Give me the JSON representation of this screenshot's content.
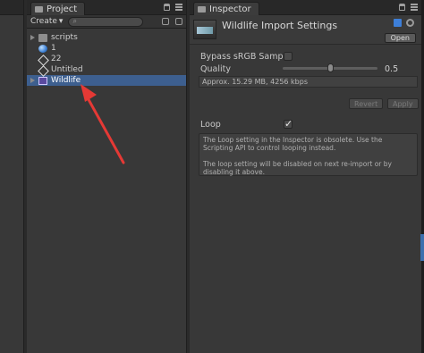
{
  "project": {
    "tab_label": "Project",
    "create_label": "Create",
    "create_arrow": "▾",
    "search_icon": "⌕",
    "items": [
      {
        "label": "scripts",
        "icon": "folder-icon",
        "expandable": true,
        "selected": false
      },
      {
        "label": "1",
        "icon": "sphere-icon",
        "expandable": false,
        "selected": false
      },
      {
        "label": "22",
        "icon": "unity-scene-icon",
        "expandable": false,
        "selected": false
      },
      {
        "label": "Untitled",
        "icon": "unity-scene-icon",
        "expandable": false,
        "selected": false
      },
      {
        "label": "Wildlife",
        "icon": "video-clip-icon",
        "expandable": true,
        "selected": true
      }
    ]
  },
  "inspector": {
    "tab_label": "Inspector",
    "title": "Wildlife Import Settings",
    "open_label": "Open",
    "bypass_label": "Bypass sRGB Sampl",
    "bypass_checked": false,
    "quality_label": "Quality",
    "quality_value": "0.5",
    "quality_fraction": 0.5,
    "info_text": "Approx. 15.29 MB, 4256 kbps",
    "revert_label": "Revert",
    "apply_label": "Apply",
    "loop_label": "Loop",
    "loop_checked": true,
    "help_line1": "The Loop setting in the Inspector is obsolete. Use the Scripting API to control looping instead.",
    "help_line2": "The loop setting will be disabled on next re-import or by disabling it above."
  },
  "colors": {
    "selection": "#3d5f8f",
    "annotation_arrow": "#e53935"
  }
}
